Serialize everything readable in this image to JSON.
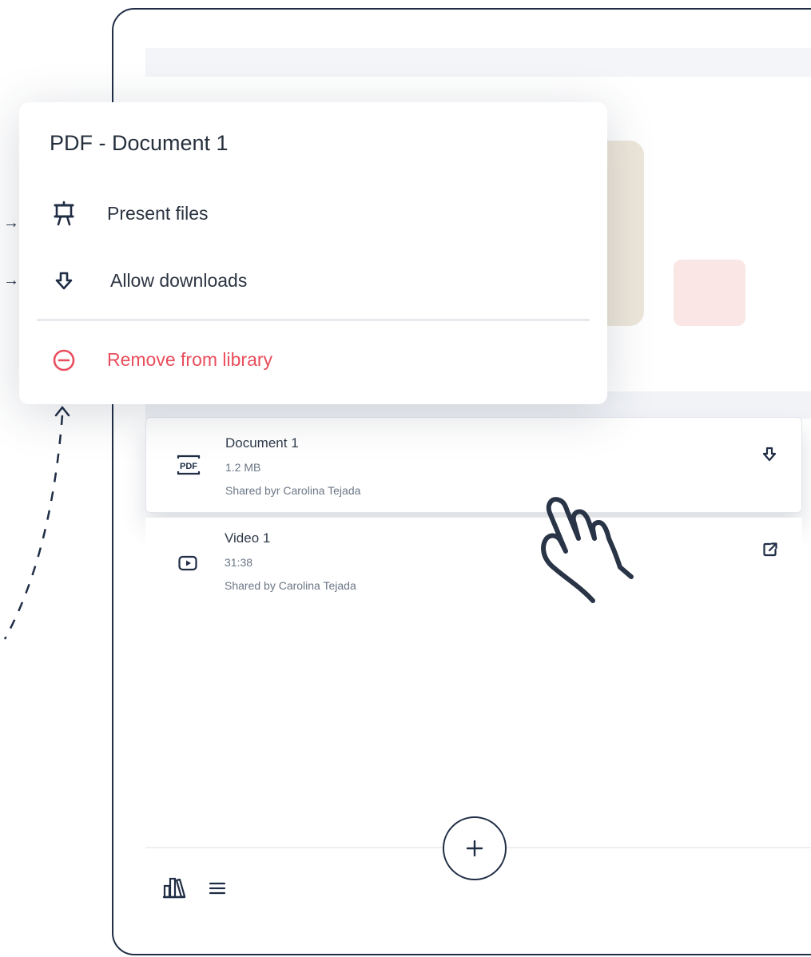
{
  "menu": {
    "title": "PDF - Document 1",
    "items": [
      {
        "label": "Present files",
        "icon": "presentation-icon"
      },
      {
        "label": "Allow downloads",
        "icon": "download-arrow-icon"
      },
      {
        "label": "Remove from library",
        "icon": "remove-circle-icon",
        "color": "#e84e5d"
      }
    ]
  },
  "files": [
    {
      "name": "Document 1",
      "meta": "1.2 MB",
      "owner": "Shared byr Carolina Tejada",
      "type_icon": "pdf-icon",
      "type_label": "PDF",
      "action_icon": "download-arrow-icon"
    },
    {
      "name": "Video 1",
      "meta": "31:38",
      "owner": "Shared by Carolina Tejada",
      "type_icon": "video-play-icon",
      "action_icon": "external-link-icon"
    }
  ],
  "bottom_nav": {
    "add_icon": "plus-icon",
    "library_icon": "library-books-icon",
    "list_icon": "hamburger-menu-icon"
  },
  "colors": {
    "frame": "#1f2d45",
    "danger": "#e84e5d",
    "text": "#2b3441",
    "muted": "#6b7686"
  }
}
